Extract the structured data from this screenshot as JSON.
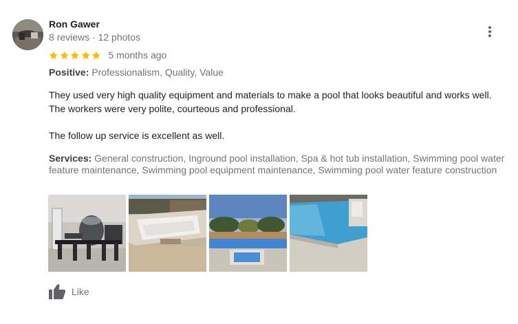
{
  "review": {
    "author": "Ron Gawer",
    "reviews_count": "8 reviews",
    "separator": " · ",
    "photos_count": "12 photos",
    "rating": 5,
    "rating_max": 5,
    "time_ago": "5 months ago",
    "positive_label": "Positive:",
    "positive_values": "Professionalism, Quality, Value",
    "paragraph1_line1": "They used very high quality equipment and materials to make a pool that looks beautiful and works well.",
    "paragraph1_line2": "The workers were very polite, courteous and professional.",
    "paragraph2": "The follow up service is excellent as well.",
    "services_label": "Services:",
    "services_values": "General construction, Inground pool installation, Spa & hot tub installation, Swimming pool water feature maintenance, Swimming pool equipment maintenance, Swimming pool water feature construction",
    "like_label": "Like"
  },
  "photos": [
    {
      "name": "pool-equipment-photo"
    },
    {
      "name": "pool-under-construction-photo"
    },
    {
      "name": "spa-sunset-photo"
    },
    {
      "name": "finished-pool-photo"
    }
  ],
  "colors": {
    "star": "#fbbc04",
    "secondary_text": "#70757a",
    "primary_text": "#202124"
  },
  "icons": [
    "more-vert-icon",
    "star-icon",
    "thumbs-up-icon"
  ]
}
